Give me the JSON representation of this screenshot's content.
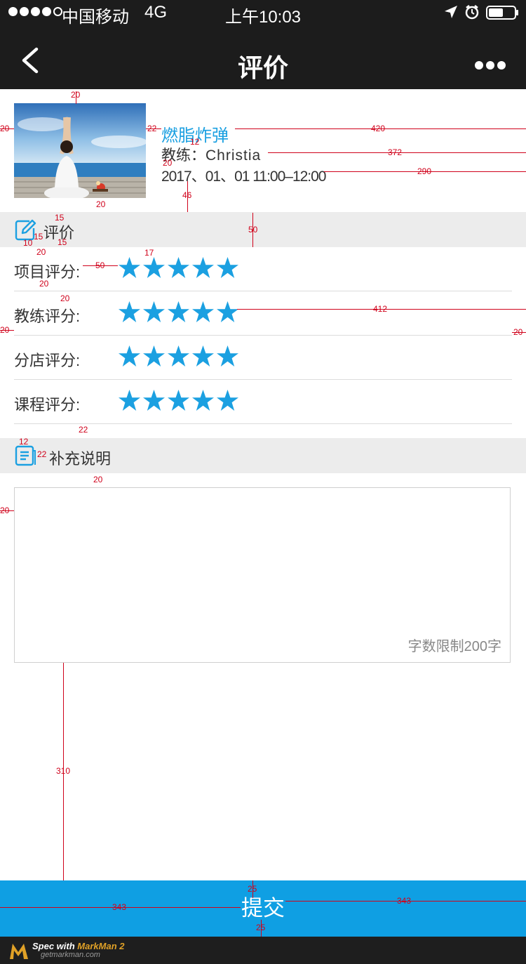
{
  "status_bar": {
    "carrier": "中国移动",
    "network": "4G",
    "time": "上午10:03"
  },
  "nav": {
    "title": "评价",
    "back_icon": "chevron-left-icon",
    "more_icon": "more-dots-icon"
  },
  "course": {
    "name": "燃脂炸弹",
    "coach_label": "教练：",
    "coach_name": "Christia",
    "time": "2017、01、01 11:00–12:00"
  },
  "rating_section": {
    "label": "评价",
    "icon": "edit-icon",
    "rows": [
      {
        "label": "项目评分:",
        "stars": 5,
        "max": 5
      },
      {
        "label": "教练评分:",
        "stars": 5,
        "max": 5
      },
      {
        "label": "分店评分:",
        "stars": 5,
        "max": 5
      },
      {
        "label": "课程评分:",
        "stars": 5,
        "max": 5
      }
    ]
  },
  "remark_section": {
    "label": "补充说明",
    "icon": "document-icon",
    "value": "",
    "limit_hint": "字数限制200字"
  },
  "submit": {
    "label": "提交"
  },
  "footer": {
    "spec_prefix": "Spec with ",
    "brand": "MarkMan 2",
    "url": "getmarkman.com"
  },
  "annotations": [
    "20",
    "20",
    "22",
    "12",
    "420",
    "372",
    "20",
    "290",
    "46",
    "20",
    "15",
    "15",
    "10",
    "20",
    "15",
    "50",
    "17",
    "50",
    "20",
    "20",
    "412",
    "20",
    "20",
    "22",
    "12",
    "22",
    "20",
    "20",
    "310",
    "25",
    "343",
    "343",
    "25"
  ],
  "colors": {
    "accent": "#1ba0e1",
    "button": "#0f9fe3",
    "bar": "#1c1c1c",
    "section_bg": "#ececec",
    "annotation": "#d0021b"
  }
}
